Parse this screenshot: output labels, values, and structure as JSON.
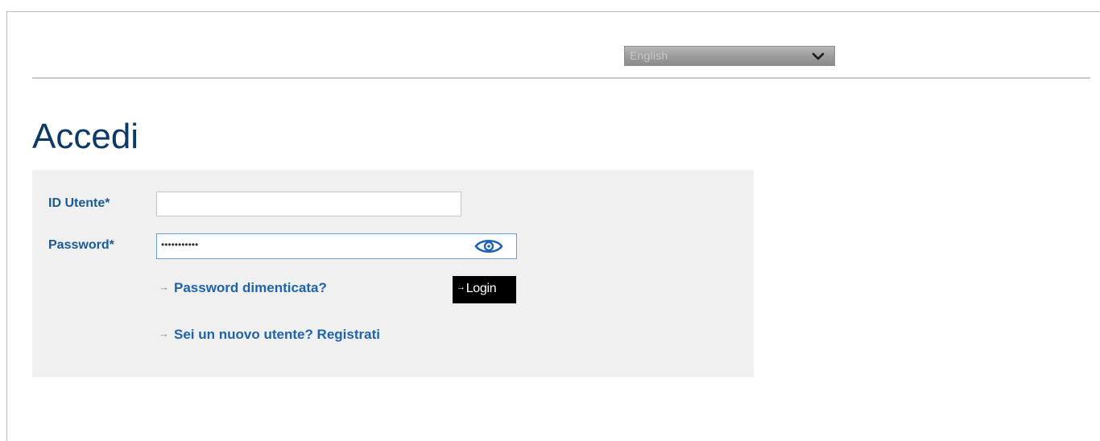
{
  "header": {
    "language_select": {
      "value": "English"
    }
  },
  "main": {
    "title": "Accedi",
    "form": {
      "user_id_label": "ID Utente*",
      "user_id_value": "",
      "password_label": "Password*",
      "password_value": "•••••••••••",
      "forgot_password_link": "Password dimenticata?",
      "register_link": "Sei un nuovo utente? Registrati",
      "login_button": "Login"
    }
  },
  "icons": {
    "language_dropdown": "chevron-down-icon",
    "password_toggle": "eye-icon",
    "link_arrow": "arrow-right-icon"
  },
  "colors": {
    "title": "#0b3a66",
    "label": "#1b5a9a",
    "link": "#1f63b0",
    "panel_background": "#f0f0f0",
    "login_button": "#000000",
    "eye_icon": "#1f63b0"
  }
}
